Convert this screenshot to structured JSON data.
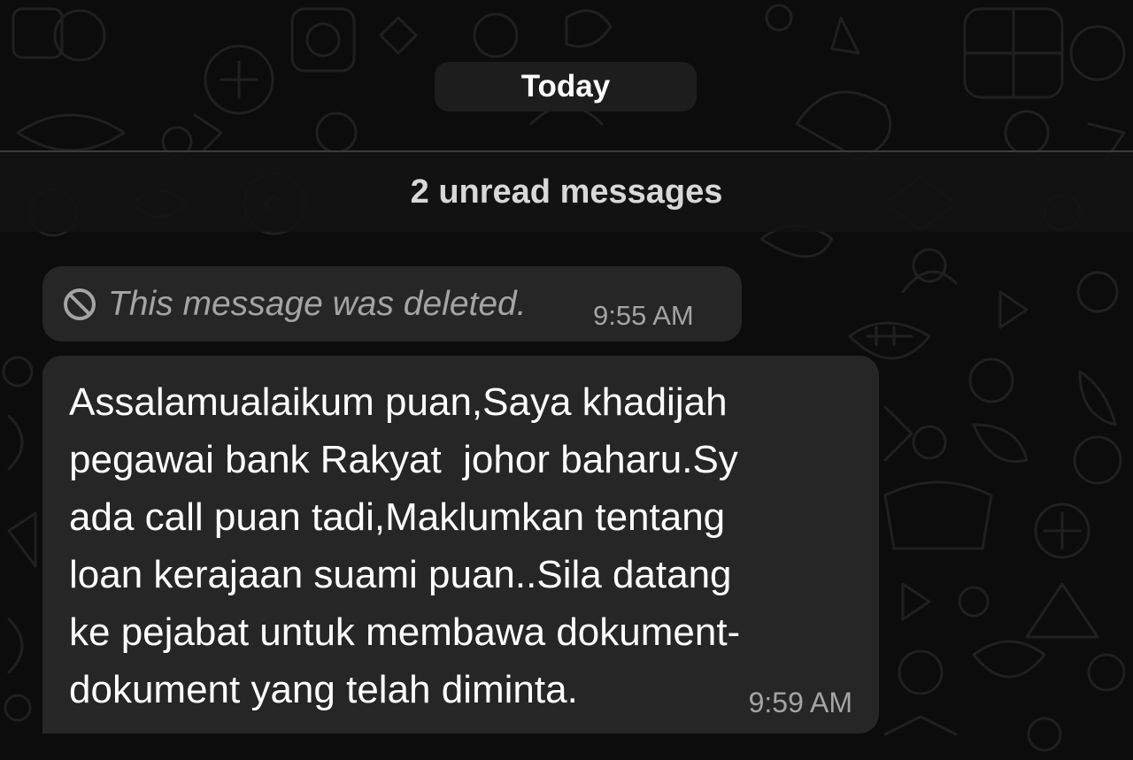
{
  "chat": {
    "date_chip": "Today",
    "unread_banner": "2 unread messages",
    "messages": [
      {
        "type": "deleted",
        "text": "This message was deleted.",
        "time": "9:55 AM",
        "icon": "ban-icon"
      },
      {
        "type": "text",
        "lines": [
          "Assalamualaikum puan,Saya khadijah",
          "pegawai bank Rakyat  johor baharu.Sy",
          "ada call puan tadi,Maklumkan tentang",
          "loan kerajaan suami puan..Sila datang",
          "ke pejabat untuk membawa dokument-",
          "dokument yang telah diminta."
        ],
        "time": "9:59 AM"
      }
    ]
  },
  "colors": {
    "background": "#0c0c0c",
    "bubble": "#262626",
    "text": "#ffffff",
    "meta_text": "#a4a4a4"
  }
}
